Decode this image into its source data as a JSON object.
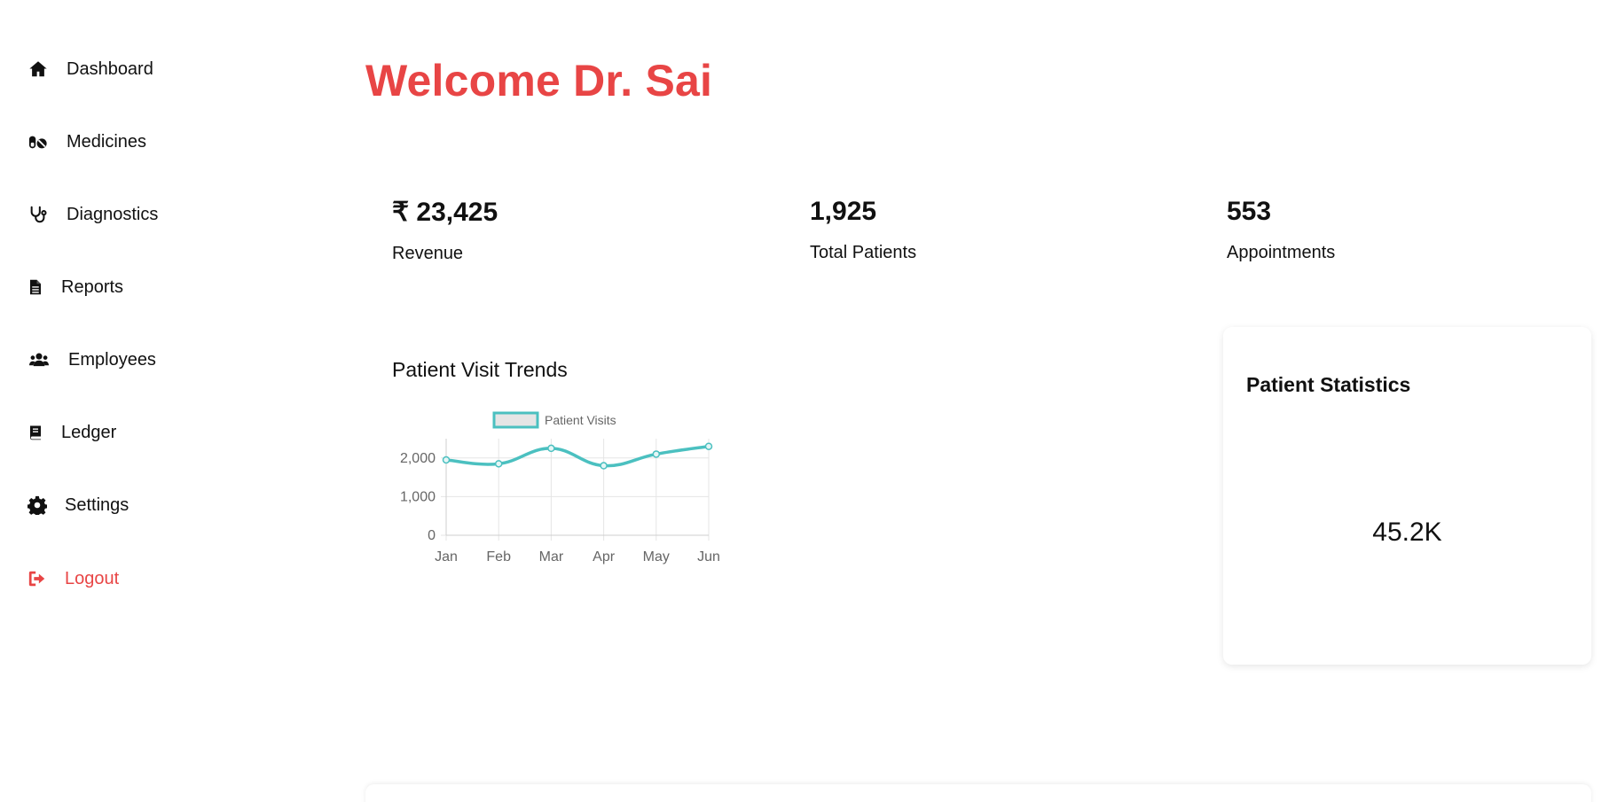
{
  "sidebar": {
    "items": [
      {
        "label": "Dashboard",
        "icon": "home-icon"
      },
      {
        "label": "Medicines",
        "icon": "pills-icon"
      },
      {
        "label": "Diagnostics",
        "icon": "stethoscope-icon"
      },
      {
        "label": "Reports",
        "icon": "file-icon"
      },
      {
        "label": "Employees",
        "icon": "users-icon"
      },
      {
        "label": "Ledger",
        "icon": "book-icon"
      },
      {
        "label": "Settings",
        "icon": "gear-icon"
      },
      {
        "label": "Logout",
        "icon": "logout-icon",
        "color": "#e84545"
      }
    ]
  },
  "header": {
    "title": "Welcome Dr. Sai",
    "title_color": "#e84545"
  },
  "stats": [
    {
      "value": "₹ 23,425",
      "label": "Revenue"
    },
    {
      "value": "1,925",
      "label": "Total Patients"
    },
    {
      "value": "553",
      "label": "Appointments"
    }
  ],
  "trend": {
    "title": "Patient Visit Trends"
  },
  "chart_data": {
    "type": "line",
    "title": "",
    "categories": [
      "Jan",
      "Feb",
      "Mar",
      "Apr",
      "May",
      "Jun"
    ],
    "series": [
      {
        "name": "Patient Visits",
        "values": [
          1950,
          1850,
          2250,
          1800,
          2100,
          2300
        ],
        "color": "#4bc0c0"
      }
    ],
    "ylim": [
      0,
      2500
    ],
    "yticks": [
      0,
      1000,
      2000
    ],
    "ytick_labels": [
      "0",
      "1,000",
      "2,000"
    ],
    "grid": true,
    "legend": "top"
  },
  "patient_statistics": {
    "title": "Patient Statistics",
    "value": "45.2K"
  }
}
